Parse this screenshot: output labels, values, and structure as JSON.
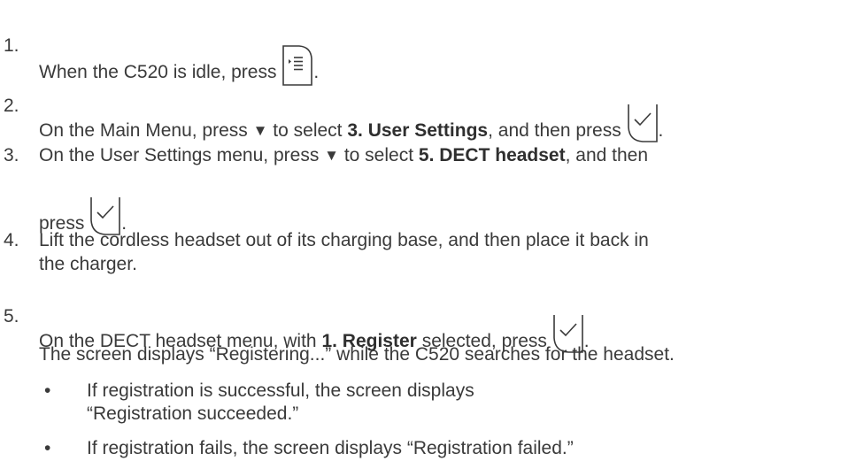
{
  "steps": [
    {
      "num": "1.",
      "pre": "When the C520 is idle, press",
      "post": ".",
      "key_icon": "menu-key-icon"
    },
    {
      "num": "2.",
      "pre": "On the Main Menu, press",
      "arrow": "▼",
      "mid": "to select",
      "bold": "3. User Settings",
      "post": ", and then press",
      "end": ".",
      "key_icon": "select-check-key-icon"
    },
    {
      "num": "3.",
      "pre": "On the User Settings menu, press",
      "arrow": "▼",
      "mid": "to select",
      "bold": "5. DECT headset",
      "post": ", and then",
      "line2": "press",
      "end": ".",
      "key_icon": "select-check-key-icon"
    },
    {
      "num": "4.",
      "line1": "Lift the cordless headset out of its charging base, and then place it back in",
      "line2": "the charger."
    },
    {
      "num": "5.",
      "pre": "On the DECT headset menu, with",
      "bold": "1. Register",
      "post": "selected, press",
      "end": ".",
      "key_icon": "select-check-key-icon",
      "note": "The screen displays “Registering...” while the C520 searches for the headset."
    }
  ],
  "bullets": [
    {
      "symbol": "•",
      "line1": "If registration is successful, the screen displays",
      "line2": "“Registration succeeded.”"
    },
    {
      "symbol": "•",
      "line1": "If registration fails, the screen displays “Registration failed.”"
    }
  ]
}
